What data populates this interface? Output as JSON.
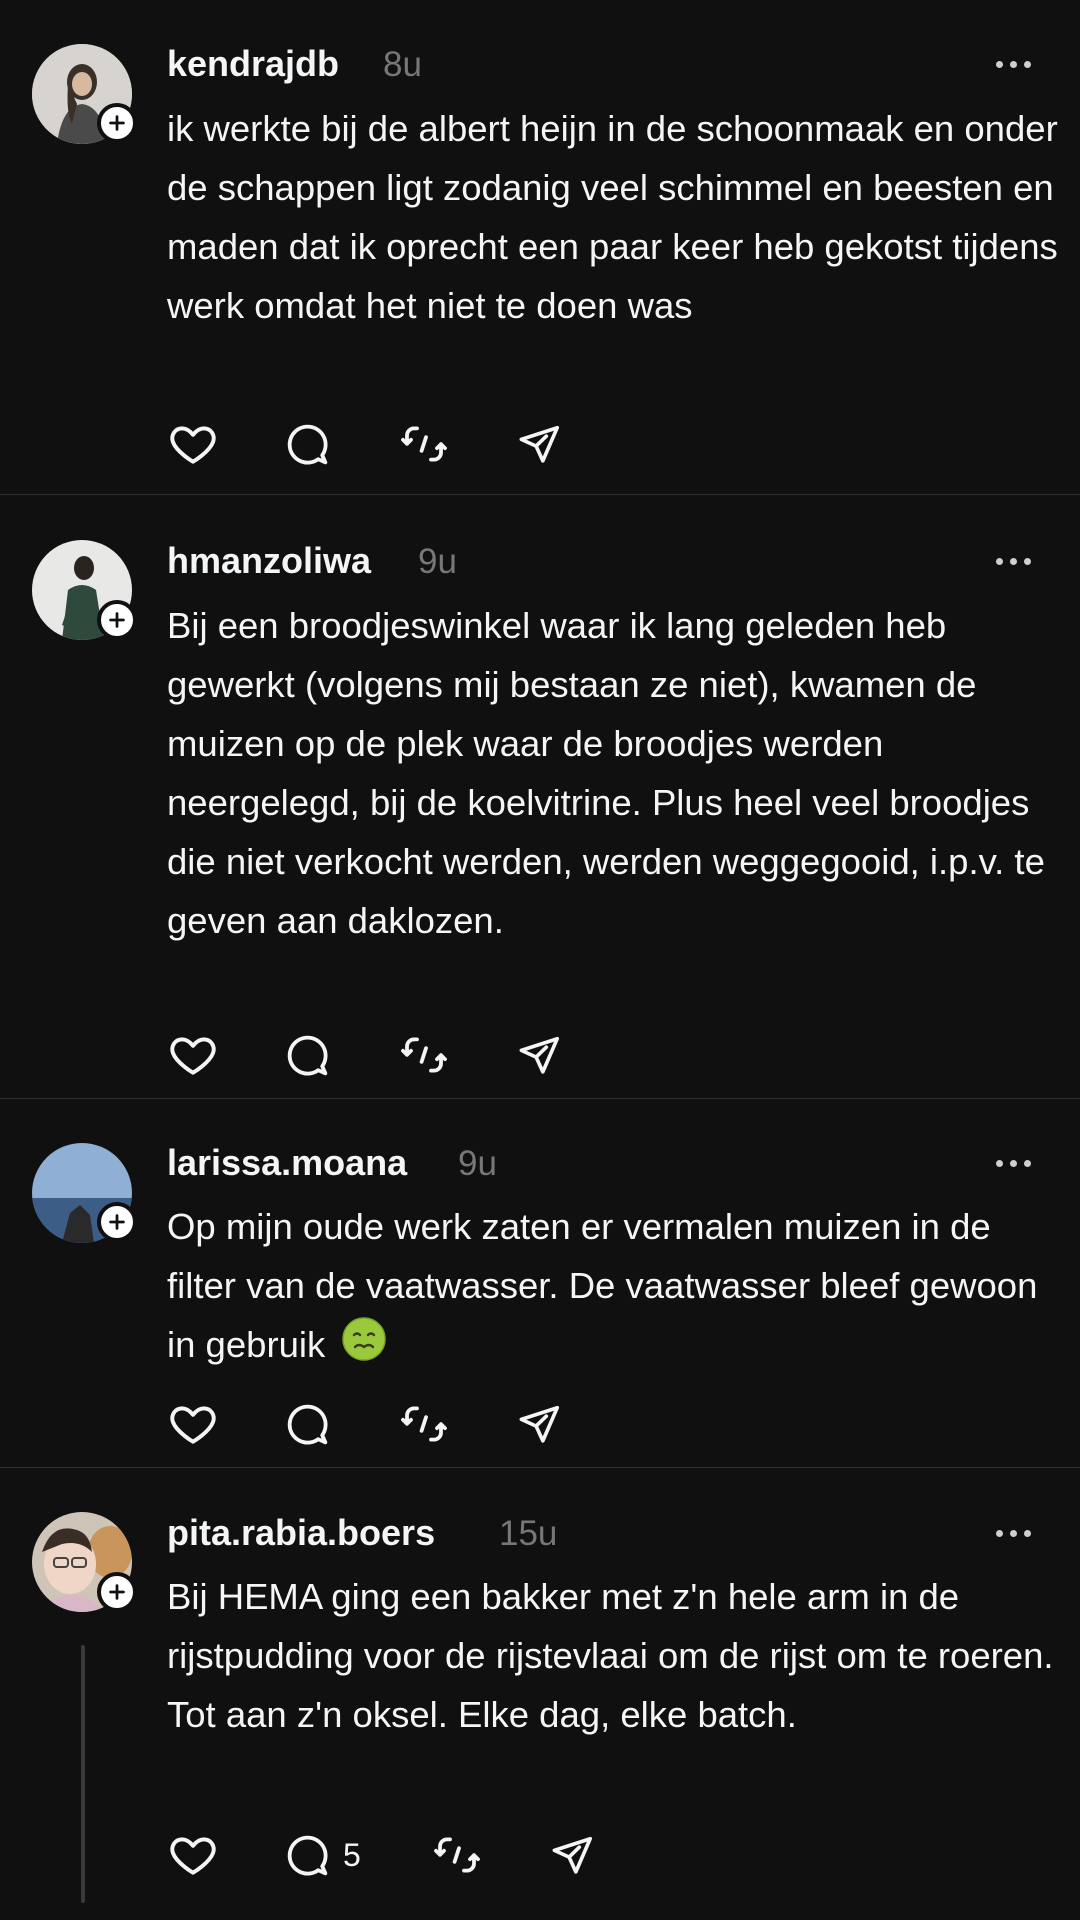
{
  "posts": [
    {
      "username": "kendrajdb",
      "time": "8u",
      "text": "ik werkte bij de albert heijn in de schoonmaak en onder de schappen ligt zodanig veel schimmel en beesten en maden dat ik oprecht een paar keer heb gekotst tijdens werk omdat het niet te doen was"
    },
    {
      "username": "hmanzoliwa",
      "time": "9u",
      "text": "Bij een broodjeswinkel waar ik lang geleden heb gewerkt (volgens mij bestaan ze niet), kwamen de muizen op de plek waar de broodjes werden neergelegd, bij de koelvitrine. Plus heel veel broodjes die niet verkocht werden, werden weggegooid, i.p.v. te geven aan daklozen."
    },
    {
      "username": "larissa.moana",
      "time": "9u",
      "text": "Op mijn oude werk zaten er vermalen muizen in de filter van de vaatwasser. De vaatwasser bleef gewoon in gebruik",
      "emoji": "nauseated-face"
    },
    {
      "username": "pita.rabia.boers",
      "time": "15u",
      "text": "Bij HEMA ging een bakker met z'n hele arm in de rijstpudding voor de rijstevlaai om de rijst om te roeren. Tot aan z'n oksel. Elke dag, elke batch.",
      "reply_count": "5"
    }
  ],
  "icons": {
    "like": "heart-icon",
    "reply": "comment-icon",
    "repost": "repost-icon",
    "share": "send-icon",
    "more": "more-icon",
    "follow": "plus-icon"
  },
  "colors": {
    "background": "#101010",
    "text": "#f3f5f7",
    "muted": "#777777",
    "divider": "#2e2e2e"
  }
}
